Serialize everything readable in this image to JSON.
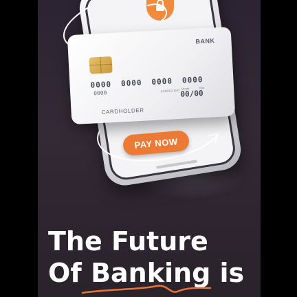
{
  "card": {
    "bank_label": "BANK",
    "number_groups": [
      "0000",
      "0000",
      "0000",
      "0000"
    ],
    "small_number": "0000",
    "expires_label": "EXPIRES END",
    "month_label": "Month",
    "year_label": "Year",
    "expiry": "00/00",
    "holder": "CARDHOLDER"
  },
  "phone": {
    "pay_button_label": "PAY NOW"
  },
  "headline": {
    "line1": "The Future",
    "line2": "Of Banking is"
  },
  "colors": {
    "accent": "#ec7a34",
    "background": "#2f2633"
  }
}
